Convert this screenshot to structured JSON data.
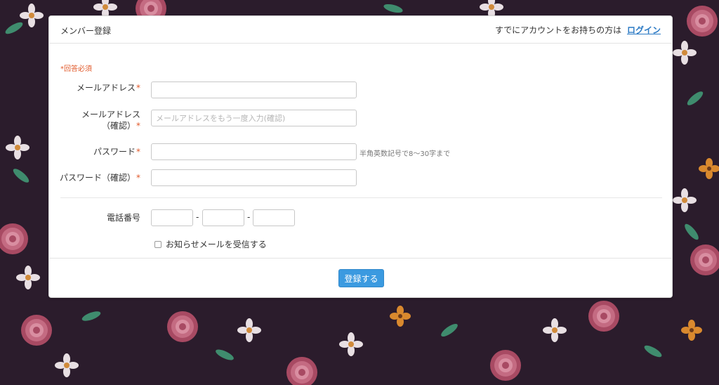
{
  "header": {
    "title": "メンバー登録",
    "login_prompt": "すでにアカウントをお持ちの方は",
    "login_link": "ログイン"
  },
  "form": {
    "required_note": "*回答必須",
    "required_mark": "*",
    "email": {
      "label": "メールアドレス",
      "value": "",
      "placeholder": ""
    },
    "email_confirm": {
      "label_line1": "メールアドレス",
      "label_line2": "（確認）",
      "value": "",
      "placeholder": "メールアドレスをもう一度入力(確認)"
    },
    "password": {
      "label": "パスワード",
      "value": "",
      "placeholder": "",
      "hint": "半角英数記号で8～30字まで"
    },
    "password_confirm": {
      "label": "パスワード（確認）",
      "value": "",
      "placeholder": ""
    },
    "phone": {
      "label": "電話番号",
      "separator": "-",
      "parts": [
        "",
        "",
        ""
      ]
    },
    "newsletter": {
      "label": "お知らせメールを受信する",
      "checked": false
    }
  },
  "actions": {
    "submit_label": "登録する"
  },
  "colors": {
    "accent": "#3b9ae0",
    "required": "#e0592a",
    "link": "#2a79c4",
    "background": "#2b1c2c"
  }
}
